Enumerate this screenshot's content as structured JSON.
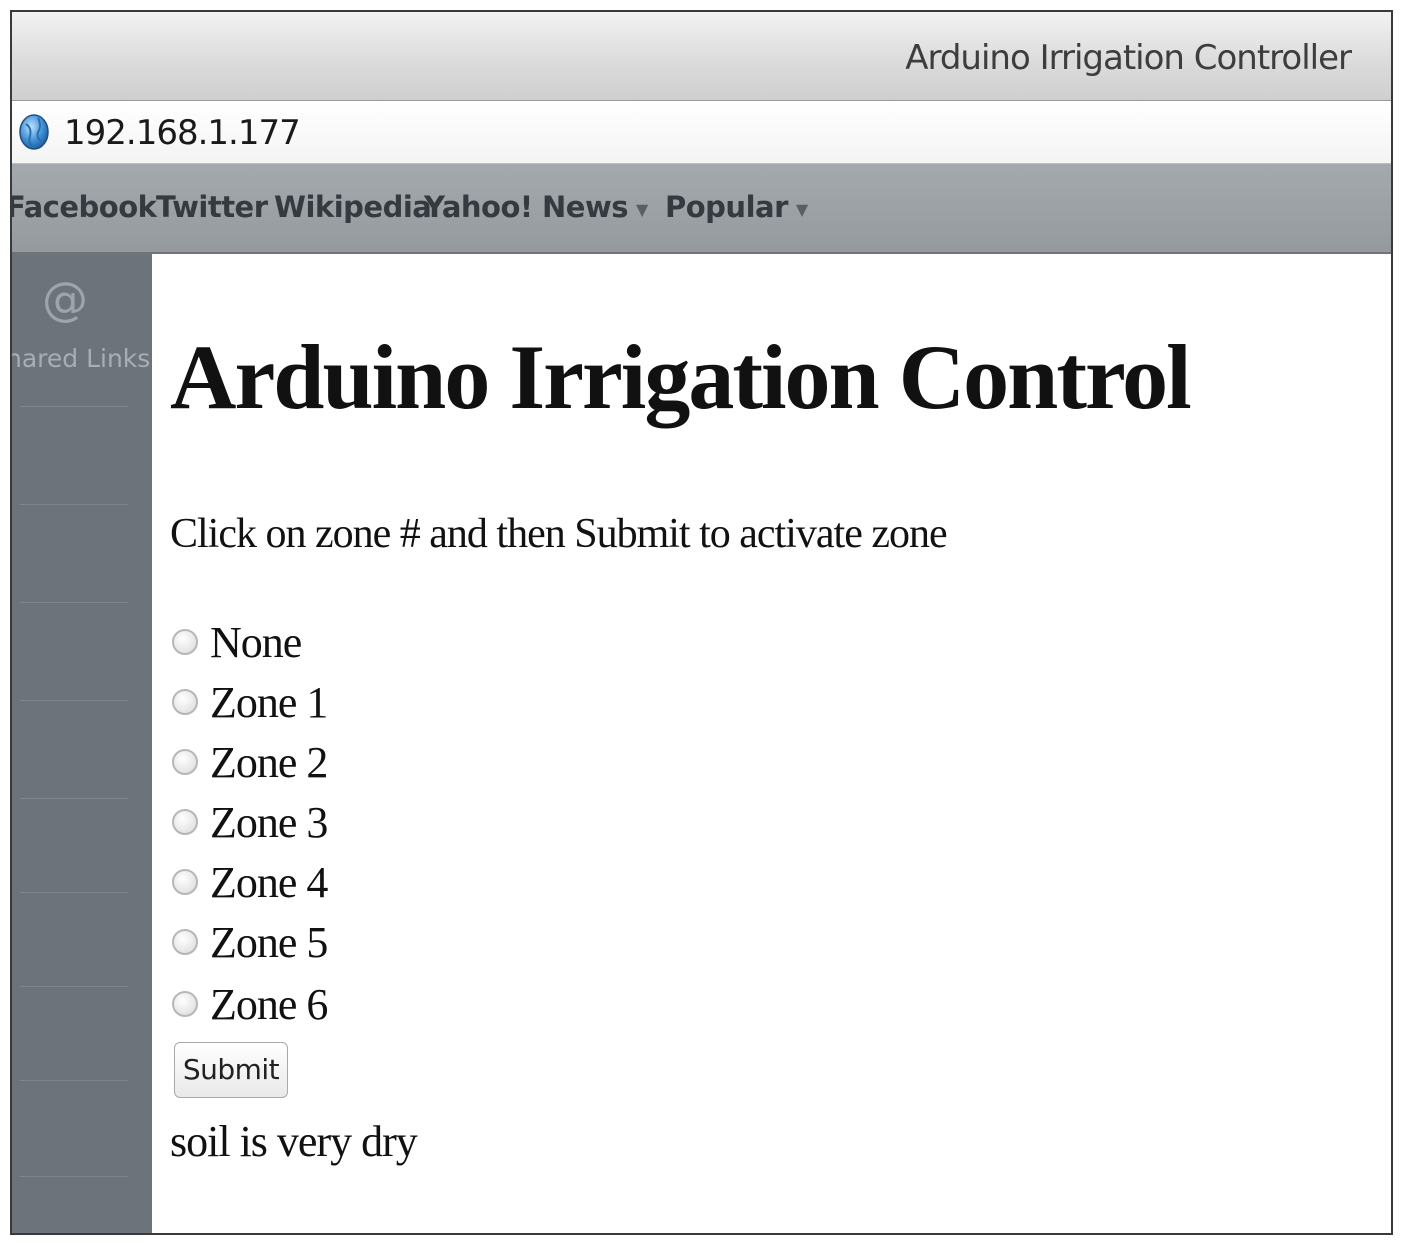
{
  "window": {
    "title": "Arduino Irrigation Controller"
  },
  "address_bar": {
    "url": "192.168.1.177"
  },
  "bookmarks": [
    {
      "label": "Facebook",
      "has_menu": false
    },
    {
      "label": "Twitter",
      "has_menu": false
    },
    {
      "label": "Wikipedia",
      "has_menu": false
    },
    {
      "label": "Yahoo!",
      "has_menu": false
    },
    {
      "label": "News",
      "has_menu": true
    },
    {
      "label": "Popular",
      "has_menu": true
    }
  ],
  "sidebar": {
    "icon": "at-icon",
    "icon_glyph": "@",
    "label": "hared Links"
  },
  "page": {
    "heading": "Arduino Irrigation Control",
    "instruction": "Click on zone # and then Submit to activate zone",
    "zones": [
      "None",
      "Zone 1",
      "Zone 2",
      "Zone 3",
      "Zone 4",
      "Zone 5",
      "Zone 6"
    ],
    "submit_label": "Submit",
    "status": "soil is very dry"
  }
}
